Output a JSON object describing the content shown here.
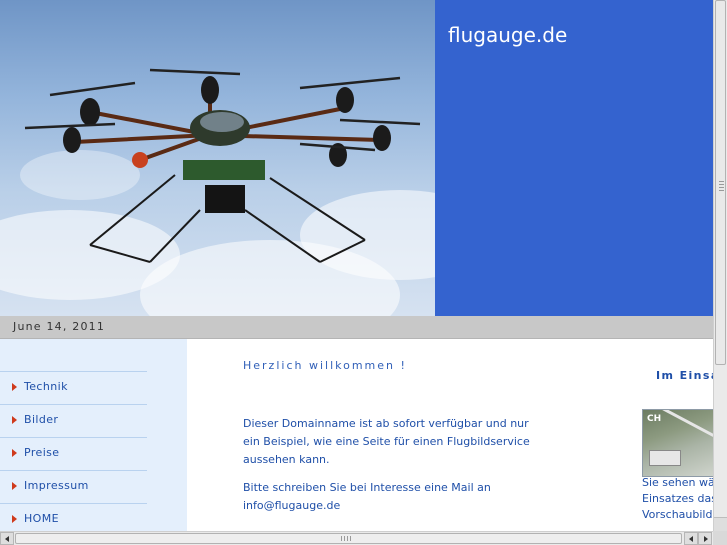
{
  "header": {
    "site_title": "flugauge.de",
    "hero_image": "drone-hexacopter-photo",
    "accent_color": "#3463cf"
  },
  "datebar": {
    "date": "June 14, 2011"
  },
  "nav": {
    "items": [
      {
        "label": "Technik"
      },
      {
        "label": "Bilder"
      },
      {
        "label": "Preise"
      },
      {
        "label": "Impressum"
      },
      {
        "label": "HOME"
      }
    ]
  },
  "main": {
    "welcome": "Herzlich willkommen !",
    "paragraph1": "Dieser Domainname ist ab sofort verfügbar und nur ein Beispiel, wie eine Seite für einen Flugbildservice aussehen kann.",
    "paragraph2": "Bitte schreiben Sie bei Interesse eine Mail an info@flugauge.de"
  },
  "sidebar": {
    "heading": "Im Einsa",
    "thumbnail": "aerial-photo-thumbnail",
    "text_line1": "Sie sehen wäh",
    "text_line2": "Einsatzes das",
    "text_line3": "Vorschaubild"
  }
}
